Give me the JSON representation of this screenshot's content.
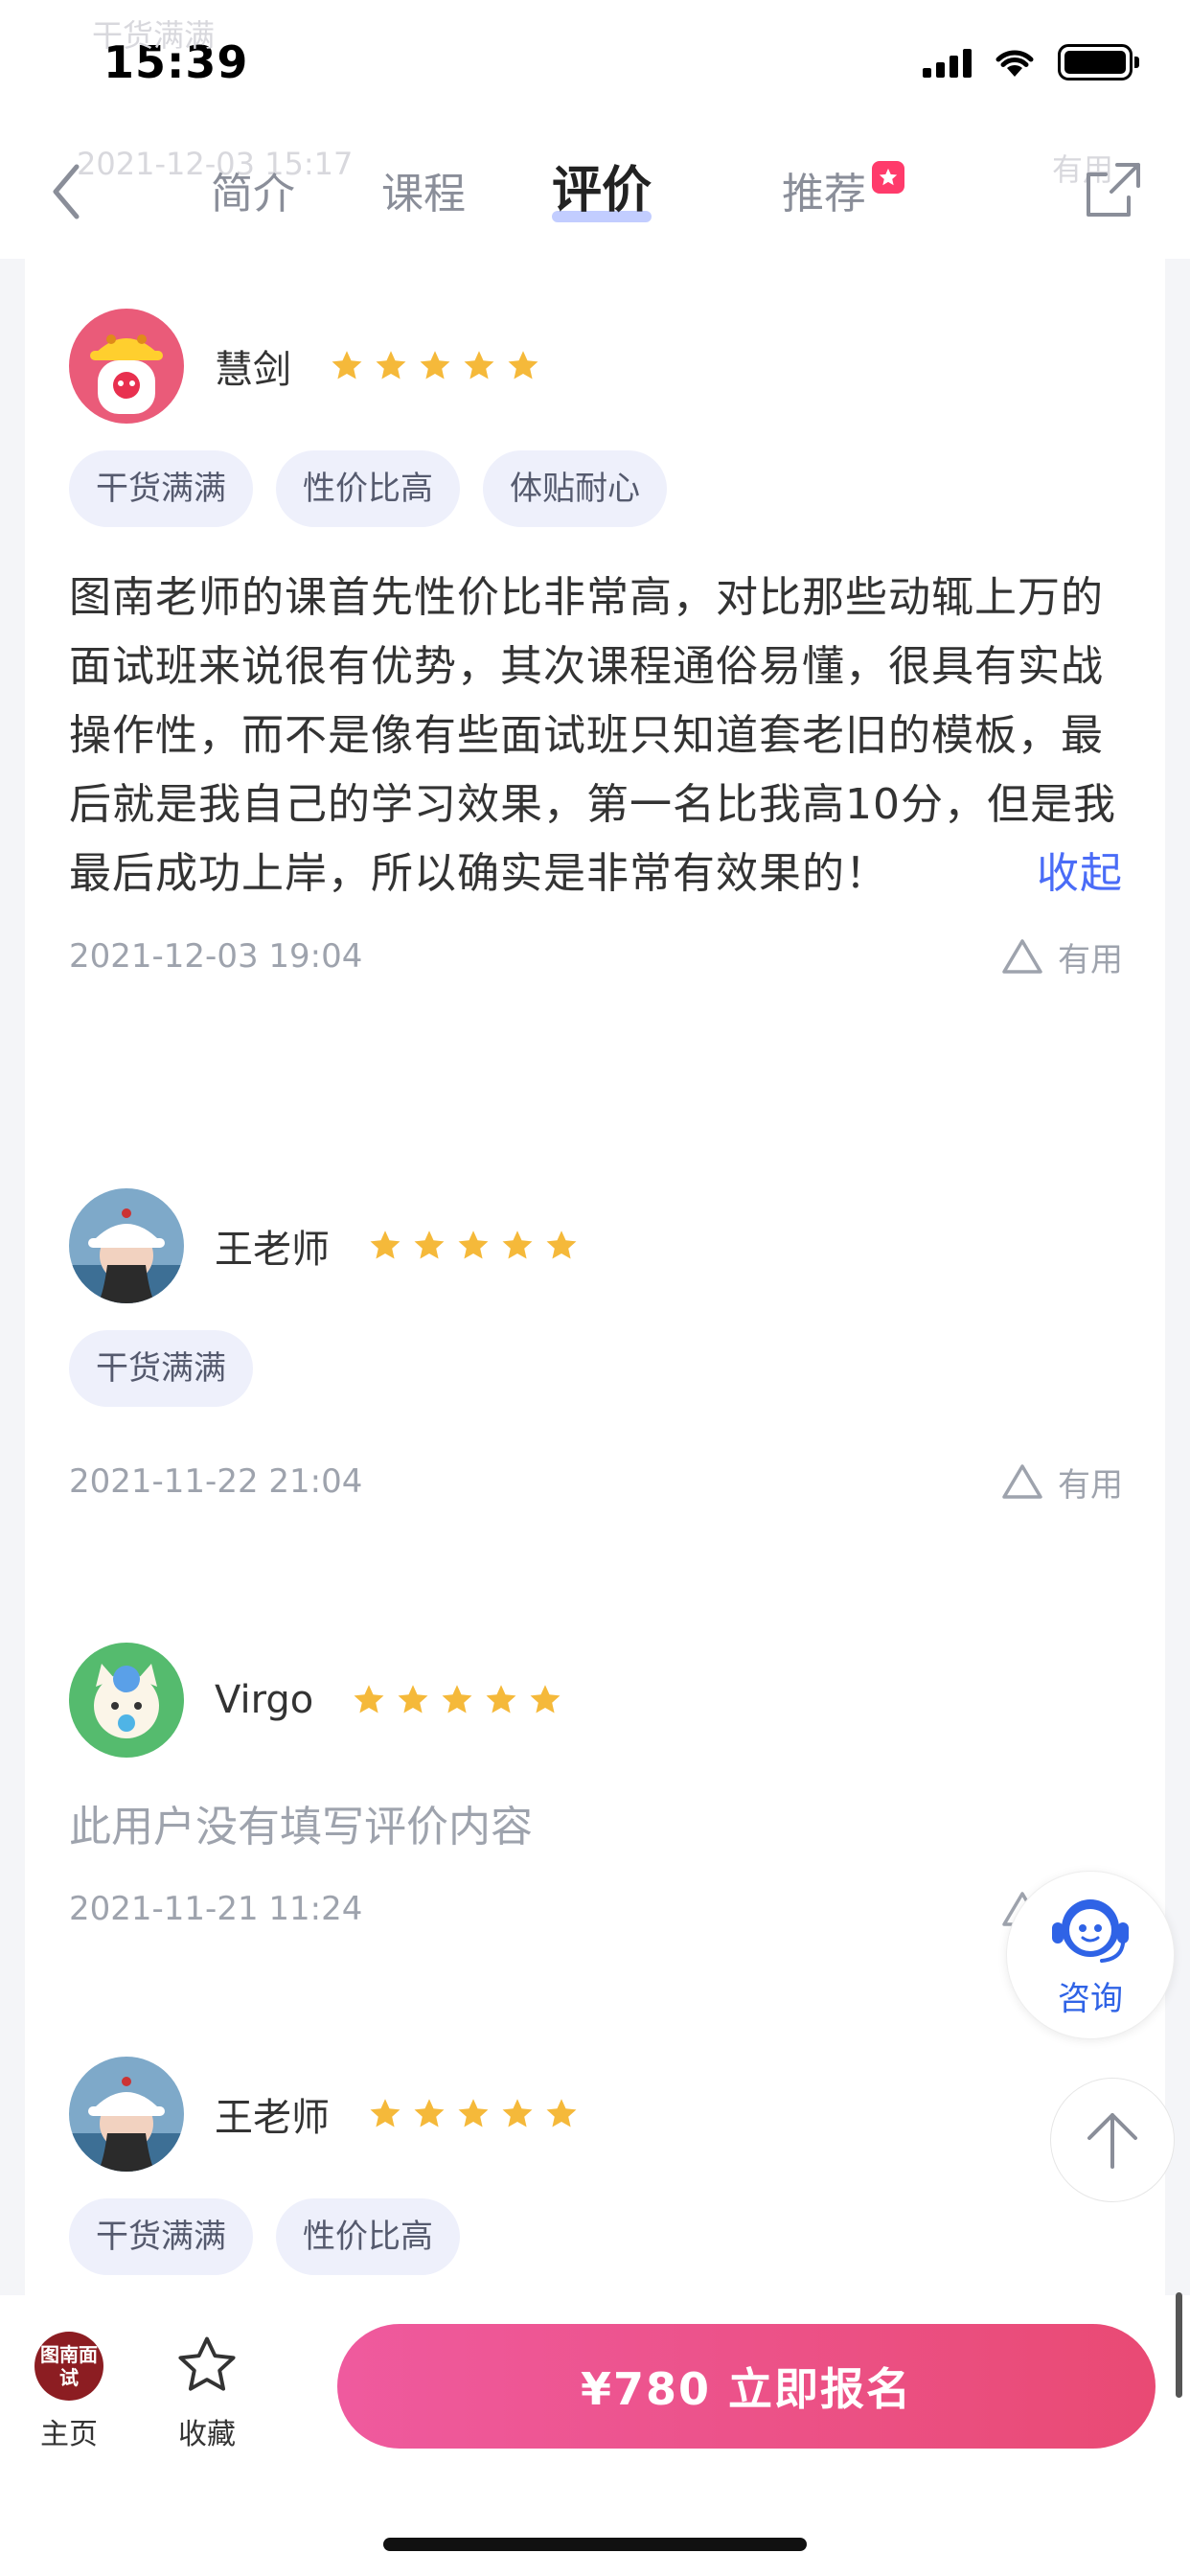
{
  "status_bar": {
    "time": "15:39"
  },
  "nav": {
    "ghost_tag": "干货满满",
    "ghost_date": "2021-12-03 15:17",
    "ghost_useful": "有用",
    "tabs": [
      {
        "label": "简介"
      },
      {
        "label": "课程"
      },
      {
        "label": "评价"
      },
      {
        "label": "推荐"
      }
    ],
    "active_tab": "评价"
  },
  "reviews": [
    {
      "user": "慧剑",
      "stars": 5,
      "tags": [
        "干货满满",
        "性价比高",
        "体贴耐心"
      ],
      "text": "图南老师的课首先性价比非常高，对比那些动辄上万的面试班来说很有优势，其次课程通俗易懂，很具有实战操作性，而不是像有些面试班只知道套老旧的模板，最后就是我自己的学习效果，第一名比我高10分，但是我最后成功上岸，所以确实是非常有效果的！",
      "collapse_label": "收起",
      "date": "2021-12-03 19:04",
      "useful_label": "有用"
    },
    {
      "user": "王老师",
      "stars": 5,
      "tags": [
        "干货满满"
      ],
      "date": "2021-11-22 21:04",
      "useful_label": "有用"
    },
    {
      "user": "Virgo",
      "stars": 5,
      "empty_text": "此用户没有填写评价内容",
      "date": "2021-11-21 11:24",
      "useful_label": "有用"
    },
    {
      "user": "王老师",
      "stars": 5,
      "tags": [
        "干货满满",
        "性价比高"
      ]
    }
  ],
  "floating": {
    "consult_label": "咨询"
  },
  "bottom_bar": {
    "logo_text": "图南面试",
    "home_label": "主页",
    "favorite_label": "收藏",
    "enroll_label": "¥780  立即报名"
  },
  "colors": {
    "star": "#f5b93a",
    "accent_blue": "#4a6cf7",
    "enroll_gradient_start": "#ef5a9e",
    "enroll_gradient_end": "#e94a74",
    "tag_bg": "#eef0fb"
  }
}
